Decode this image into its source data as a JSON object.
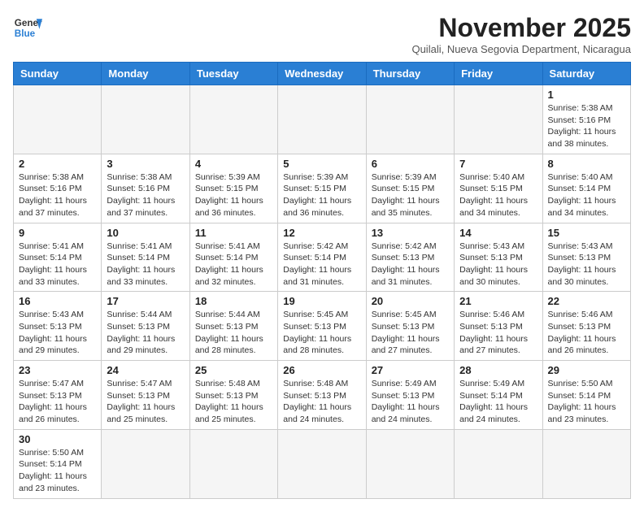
{
  "header": {
    "logo_line1": "General",
    "logo_line2": "Blue",
    "month_title": "November 2025",
    "subtitle": "Quilali, Nueva Segovia Department, Nicaragua"
  },
  "days_of_week": [
    "Sunday",
    "Monday",
    "Tuesday",
    "Wednesday",
    "Thursday",
    "Friday",
    "Saturday"
  ],
  "weeks": [
    [
      {
        "day": "",
        "info": ""
      },
      {
        "day": "",
        "info": ""
      },
      {
        "day": "",
        "info": ""
      },
      {
        "day": "",
        "info": ""
      },
      {
        "day": "",
        "info": ""
      },
      {
        "day": "",
        "info": ""
      },
      {
        "day": "1",
        "info": "Sunrise: 5:38 AM\nSunset: 5:16 PM\nDaylight: 11 hours and 38 minutes."
      }
    ],
    [
      {
        "day": "2",
        "info": "Sunrise: 5:38 AM\nSunset: 5:16 PM\nDaylight: 11 hours and 37 minutes."
      },
      {
        "day": "3",
        "info": "Sunrise: 5:38 AM\nSunset: 5:16 PM\nDaylight: 11 hours and 37 minutes."
      },
      {
        "day": "4",
        "info": "Sunrise: 5:39 AM\nSunset: 5:15 PM\nDaylight: 11 hours and 36 minutes."
      },
      {
        "day": "5",
        "info": "Sunrise: 5:39 AM\nSunset: 5:15 PM\nDaylight: 11 hours and 36 minutes."
      },
      {
        "day": "6",
        "info": "Sunrise: 5:39 AM\nSunset: 5:15 PM\nDaylight: 11 hours and 35 minutes."
      },
      {
        "day": "7",
        "info": "Sunrise: 5:40 AM\nSunset: 5:15 PM\nDaylight: 11 hours and 34 minutes."
      },
      {
        "day": "8",
        "info": "Sunrise: 5:40 AM\nSunset: 5:14 PM\nDaylight: 11 hours and 34 minutes."
      }
    ],
    [
      {
        "day": "9",
        "info": "Sunrise: 5:41 AM\nSunset: 5:14 PM\nDaylight: 11 hours and 33 minutes."
      },
      {
        "day": "10",
        "info": "Sunrise: 5:41 AM\nSunset: 5:14 PM\nDaylight: 11 hours and 33 minutes."
      },
      {
        "day": "11",
        "info": "Sunrise: 5:41 AM\nSunset: 5:14 PM\nDaylight: 11 hours and 32 minutes."
      },
      {
        "day": "12",
        "info": "Sunrise: 5:42 AM\nSunset: 5:14 PM\nDaylight: 11 hours and 31 minutes."
      },
      {
        "day": "13",
        "info": "Sunrise: 5:42 AM\nSunset: 5:13 PM\nDaylight: 11 hours and 31 minutes."
      },
      {
        "day": "14",
        "info": "Sunrise: 5:43 AM\nSunset: 5:13 PM\nDaylight: 11 hours and 30 minutes."
      },
      {
        "day": "15",
        "info": "Sunrise: 5:43 AM\nSunset: 5:13 PM\nDaylight: 11 hours and 30 minutes."
      }
    ],
    [
      {
        "day": "16",
        "info": "Sunrise: 5:43 AM\nSunset: 5:13 PM\nDaylight: 11 hours and 29 minutes."
      },
      {
        "day": "17",
        "info": "Sunrise: 5:44 AM\nSunset: 5:13 PM\nDaylight: 11 hours and 29 minutes."
      },
      {
        "day": "18",
        "info": "Sunrise: 5:44 AM\nSunset: 5:13 PM\nDaylight: 11 hours and 28 minutes."
      },
      {
        "day": "19",
        "info": "Sunrise: 5:45 AM\nSunset: 5:13 PM\nDaylight: 11 hours and 28 minutes."
      },
      {
        "day": "20",
        "info": "Sunrise: 5:45 AM\nSunset: 5:13 PM\nDaylight: 11 hours and 27 minutes."
      },
      {
        "day": "21",
        "info": "Sunrise: 5:46 AM\nSunset: 5:13 PM\nDaylight: 11 hours and 27 minutes."
      },
      {
        "day": "22",
        "info": "Sunrise: 5:46 AM\nSunset: 5:13 PM\nDaylight: 11 hours and 26 minutes."
      }
    ],
    [
      {
        "day": "23",
        "info": "Sunrise: 5:47 AM\nSunset: 5:13 PM\nDaylight: 11 hours and 26 minutes."
      },
      {
        "day": "24",
        "info": "Sunrise: 5:47 AM\nSunset: 5:13 PM\nDaylight: 11 hours and 25 minutes."
      },
      {
        "day": "25",
        "info": "Sunrise: 5:48 AM\nSunset: 5:13 PM\nDaylight: 11 hours and 25 minutes."
      },
      {
        "day": "26",
        "info": "Sunrise: 5:48 AM\nSunset: 5:13 PM\nDaylight: 11 hours and 24 minutes."
      },
      {
        "day": "27",
        "info": "Sunrise: 5:49 AM\nSunset: 5:13 PM\nDaylight: 11 hours and 24 minutes."
      },
      {
        "day": "28",
        "info": "Sunrise: 5:49 AM\nSunset: 5:14 PM\nDaylight: 11 hours and 24 minutes."
      },
      {
        "day": "29",
        "info": "Sunrise: 5:50 AM\nSunset: 5:14 PM\nDaylight: 11 hours and 23 minutes."
      }
    ],
    [
      {
        "day": "30",
        "info": "Sunrise: 5:50 AM\nSunset: 5:14 PM\nDaylight: 11 hours and 23 minutes."
      },
      {
        "day": "",
        "info": ""
      },
      {
        "day": "",
        "info": ""
      },
      {
        "day": "",
        "info": ""
      },
      {
        "day": "",
        "info": ""
      },
      {
        "day": "",
        "info": ""
      },
      {
        "day": "",
        "info": ""
      }
    ]
  ]
}
